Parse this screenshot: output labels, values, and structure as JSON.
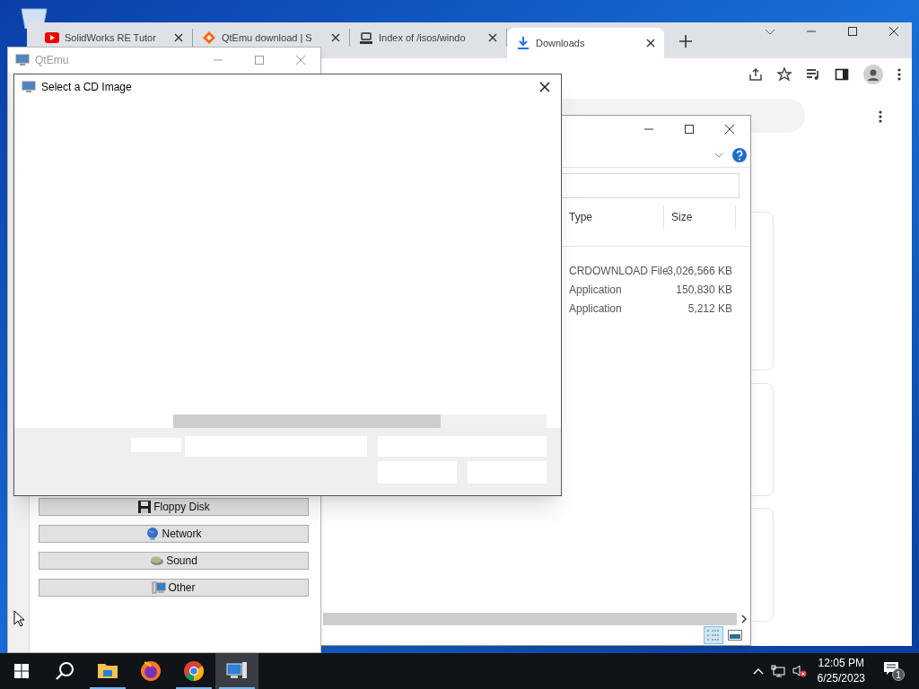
{
  "browser": {
    "tabs": [
      {
        "title": "SolidWorks RE Tutor",
        "kind": "youtube",
        "selected": false
      },
      {
        "title": "QtEmu download | S",
        "kind": "diamond",
        "selected": false
      },
      {
        "title": "Index of /isos/windo",
        "kind": "server",
        "selected": false
      },
      {
        "title": "Downloads",
        "kind": "download",
        "selected": true
      }
    ]
  },
  "explorer": {
    "columns": [
      "Type",
      "Size"
    ],
    "rows": [
      {
        "type": "CRDOWNLOAD File",
        "size": "3,026,566 KB"
      },
      {
        "type": "Application",
        "size": "150,830 KB"
      },
      {
        "type": "Application",
        "size": "5,212 KB"
      }
    ],
    "views": [
      {
        "kind": "details",
        "selected": true
      },
      {
        "kind": "tiles",
        "selected": false
      }
    ]
  },
  "qtemu": {
    "title": "QtEmu",
    "buttons": [
      {
        "label": "Floppy Disk",
        "kind": "floppy"
      },
      {
        "label": "Network",
        "kind": "globe"
      },
      {
        "label": "Sound",
        "kind": "sound"
      },
      {
        "label": "Other",
        "kind": "other"
      }
    ]
  },
  "dialog": {
    "title": "Select a CD Image"
  },
  "taskbar": {
    "apps": [
      {
        "kind": "explorer",
        "running": true,
        "active": false
      },
      {
        "kind": "firefox",
        "running": false,
        "active": false
      },
      {
        "kind": "chrome",
        "running": true,
        "active": false
      },
      {
        "kind": "qtemu",
        "running": true,
        "active": true
      }
    ],
    "time": "12:05 PM",
    "date": "6/25/2023",
    "notifications": "1"
  }
}
